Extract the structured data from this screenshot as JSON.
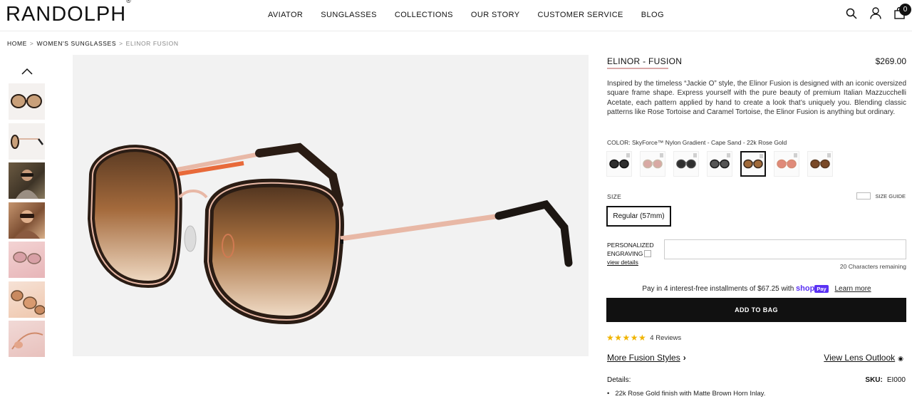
{
  "brand": {
    "logo": "RANDOLPH",
    "reg": "®"
  },
  "nav": [
    "AVIATOR",
    "SUNGLASSES",
    "COLLECTIONS",
    "OUR STORY",
    "CUSTOMER SERVICE",
    "BLOG"
  ],
  "header": {
    "bag_count": "0"
  },
  "breadcrumb": {
    "home": "HOME",
    "category": "WOMEN'S SUNGLASSES",
    "current": "ELINOR FUSION",
    "sep": ">"
  },
  "product": {
    "title": "ELINOR - FUSION",
    "price": "$269.00",
    "description": "Inspired by the timeless “Jackie O” style, the Elinor Fusion is designed with an iconic oversized square frame shape. Express yourself with the pure beauty of premium Italian Mazzucchelli Acetate, each pattern applied by hand to create a look that’s uniquely you. Blending classic patterns like Rose Tortoise and Caramel Tortoise, the Elinor Fusion is anything but ordinary.",
    "color_label": "COLOR: SkyForce™ Nylon Gradient - Cape Sand - 22k Rose Gold",
    "swatches": [
      {
        "lens": "#2e2e2e",
        "frame": "#111111"
      },
      {
        "lens": "#d9a9a4",
        "frame": "#c9b8a8"
      },
      {
        "lens": "#303030",
        "frame": "#444444"
      },
      {
        "lens": "#555555",
        "frame": "#1a1a1a"
      },
      {
        "lens": "#a06a3a",
        "frame": "#3a2a1e"
      },
      {
        "lens": "#e08a7a",
        "frame": "#d58b72"
      },
      {
        "lens": "#7a4a28",
        "frame": "#5a3a22"
      }
    ],
    "size_label": "SIZE",
    "size_guide": "SIZE GUIDE",
    "size_option": "Regular (57mm)",
    "engraving_label_1": "PERSONALIZED",
    "engraving_label_2": "ENGRAVING",
    "view_details": "view details",
    "chars_remaining": "20 Characters remaining",
    "installments_text": "Pay in 4 interest-free installments of $67.25 with",
    "shop_text": "shop",
    "pay_text": "Pay",
    "learn_more": "Learn more",
    "add_to_bag": "ADD TO BAG",
    "stars": "★★★★★",
    "rating": 5,
    "reviews": "4 Reviews",
    "more_styles": "More Fusion Styles",
    "lens_outlook": "View Lens Outlook",
    "details_label": "Details:",
    "sku_label": "SKU:",
    "sku_value": "EI000",
    "detail_1": "22k Rose Gold finish with Matte Brown Horn Inlay."
  },
  "colors": {
    "accent_underline": "#d9a9a9",
    "button": "#111111",
    "star": "#f0b400",
    "shoppay": "#5a31f4"
  }
}
